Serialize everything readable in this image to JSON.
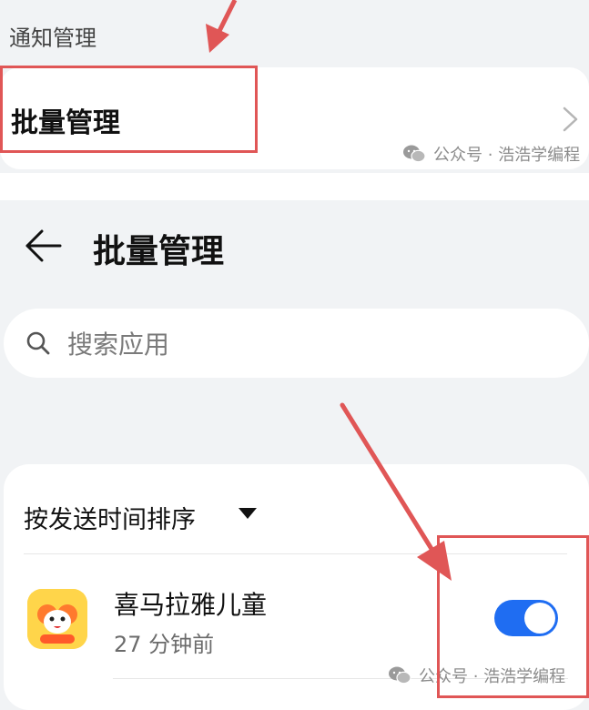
{
  "top_section": {
    "title": "通知管理",
    "item_label": "批量管理"
  },
  "watermark": {
    "text": "公众号 · 浩浩学编程"
  },
  "page": {
    "title": "批量管理"
  },
  "search": {
    "placeholder": "搜索应用"
  },
  "list": {
    "sort_label": "按发送时间排序",
    "apps": [
      {
        "name": "喜马拉雅儿童",
        "time": "27 分钟前",
        "notifications_enabled": true
      }
    ]
  },
  "colors": {
    "toggle_on": "#1f6df2",
    "annotation_red": "#e05656",
    "background": "#f1f3f5"
  }
}
